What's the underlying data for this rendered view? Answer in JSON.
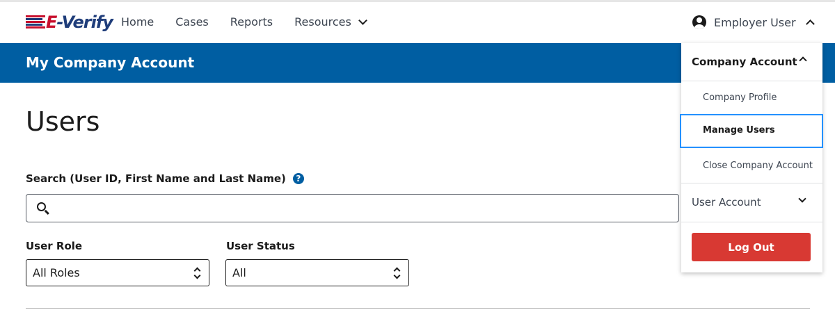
{
  "header": {
    "logo_text_e": "E",
    "logo_text_rest": "-Verify",
    "nav": [
      {
        "label": "Home"
      },
      {
        "label": "Cases"
      },
      {
        "label": "Reports"
      },
      {
        "label": "Resources"
      }
    ],
    "user_label": "Employer User"
  },
  "banner": {
    "title": "My Company Account"
  },
  "main": {
    "page_title": "Users",
    "search_label": "Search (User ID, First Name and Last Name)",
    "search_value": "",
    "help_glyph": "?",
    "role_label": "User Role",
    "role_value": "All Roles",
    "status_label": "User Status",
    "status_value": "All"
  },
  "dropdown": {
    "company_account": "Company Account",
    "items": [
      {
        "label": "Company Profile"
      },
      {
        "label": "Manage Users"
      },
      {
        "label": "Close Company Account"
      }
    ],
    "user_account": "User Account",
    "logout": "Log Out"
  },
  "colors": {
    "banner": "#005ea2",
    "logout": "#d83933",
    "focus": "#2491ff",
    "logo_blue": "#1f3d7a",
    "logo_red": "#c8102e"
  }
}
